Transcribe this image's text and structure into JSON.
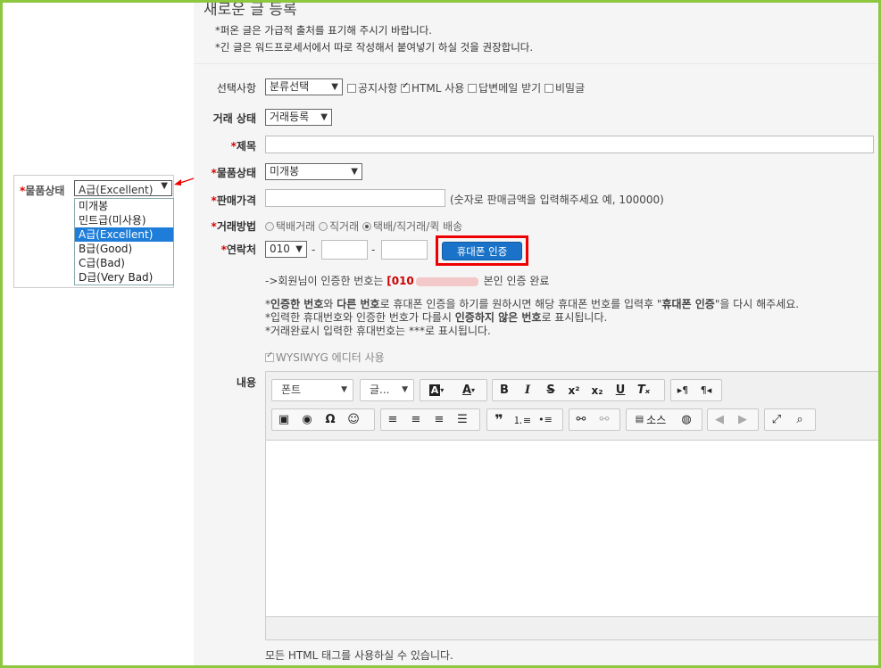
{
  "page": {
    "title": "새로운 글 등록",
    "notes": [
      "*퍼온 글은 가급적 출처를 표기해 주시기 바랍니다.",
      "*긴 글은 워드프로세서에서 따로 작성해서 붙여넣기 하실 것을 권장합니다."
    ]
  },
  "popup": {
    "label": "물품상태",
    "selected": "A급(Excellent)",
    "options": [
      "미개봉",
      "민트급(미사용)",
      "A급(Excellent)",
      "B급(Good)",
      "C급(Bad)",
      "D급(Very Bad)"
    ],
    "selected_index": 2
  },
  "form": {
    "category": {
      "label": "선택사항",
      "select": "분류선택",
      "notice": "공지사항",
      "html": "HTML 사용",
      "reply_mail": "답변메일 받기",
      "secret": "비밀글"
    },
    "trade_state": {
      "label": "거래 상태",
      "select": "거래등록"
    },
    "subject": {
      "label": "제목"
    },
    "item_state": {
      "label": "물품상태",
      "select": "미개봉"
    },
    "price": {
      "label": "판매가격",
      "hint": "(숫자로 판매금액을 입력해주세요 예, 100000)"
    },
    "trade_method": {
      "label": "거래방법",
      "options": [
        "택배거래",
        "직거래",
        "택배/직거래/퀵 배송"
      ],
      "selected_index": 2
    },
    "contact": {
      "label": "연락처",
      "prefix": "010",
      "dash": "-",
      "verify_button": "휴대폰 인증"
    },
    "verify_msg": {
      "pre": "->회원님이 인증한 번호는 ",
      "number": "[010",
      "post": " 본인 인증 완료"
    },
    "info": {
      "l1_a": "*",
      "l1_b": "인증한 번호",
      "l1_c": "와 ",
      "l1_d": "다른 번호",
      "l1_e": "로 휴대폰 인증을 하기를 원하시면 해당 휴대폰 번호를 입력후 \"",
      "l1_f": "휴대폰 인증",
      "l1_g": "\"을 다시 해주세요.",
      "l2_a": "*입력한 휴대번호와 인증한 번호가 다를시 ",
      "l2_b": "인증하지 않은 번호",
      "l2_c": "로 표시됩니다.",
      "l3": "*거래완료시 입력한 휴대번호는 ***로 표시됩니다."
    },
    "wysiwyg": "WYSIWYG 에디터 사용",
    "content_label": "내용",
    "editor": {
      "font_combo": "폰트",
      "size_combo": "글...",
      "source": "소스"
    },
    "footer_note": "모든 HTML 태그를 사용하실 수 있습니다."
  }
}
